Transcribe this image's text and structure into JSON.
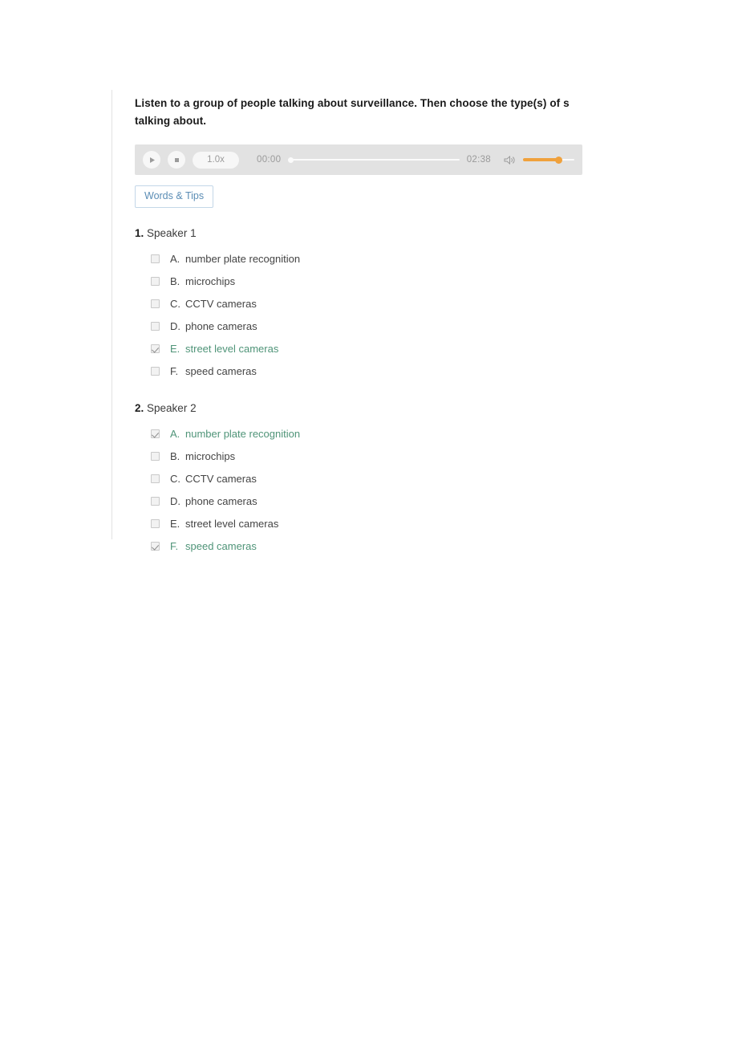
{
  "prompt": {
    "line1": "Listen to a group of people talking about surveillance. Then choose the type(s) of s",
    "line2": "talking about."
  },
  "player": {
    "play_label": "play-icon",
    "stop_label": "stop-icon",
    "speed": "1.0x",
    "current_time": "00:00",
    "duration": "02:38",
    "volume_icon": "volume-icon",
    "progress_percent": 0,
    "volume_percent": 70,
    "accent_color": "#f0a13c",
    "background_color": "#e2e2e2"
  },
  "tips_button": {
    "label": "Words & Tips",
    "text_color": "#5b8db5",
    "border_color": "#c3d7e8"
  },
  "selected_color": "#4f9478",
  "questions": [
    {
      "number": "1.",
      "title": "Speaker 1",
      "options": [
        {
          "letter": "A.",
          "text": "number plate recognition",
          "checked": false
        },
        {
          "letter": "B.",
          "text": "microchips",
          "checked": false
        },
        {
          "letter": "C.",
          "text": "CCTV cameras",
          "checked": false
        },
        {
          "letter": "D.",
          "text": "phone cameras",
          "checked": false
        },
        {
          "letter": "E.",
          "text": "street level cameras",
          "checked": true
        },
        {
          "letter": "F.",
          "text": "speed cameras",
          "checked": false
        }
      ]
    },
    {
      "number": "2.",
      "title": "Speaker 2",
      "options": [
        {
          "letter": "A.",
          "text": "number plate recognition",
          "checked": true
        },
        {
          "letter": "B.",
          "text": "microchips",
          "checked": false
        },
        {
          "letter": "C.",
          "text": "CCTV cameras",
          "checked": false
        },
        {
          "letter": "D.",
          "text": "phone cameras",
          "checked": false
        },
        {
          "letter": "E.",
          "text": "street level cameras",
          "checked": false
        },
        {
          "letter": "F.",
          "text": "speed cameras",
          "checked": true
        }
      ]
    }
  ]
}
